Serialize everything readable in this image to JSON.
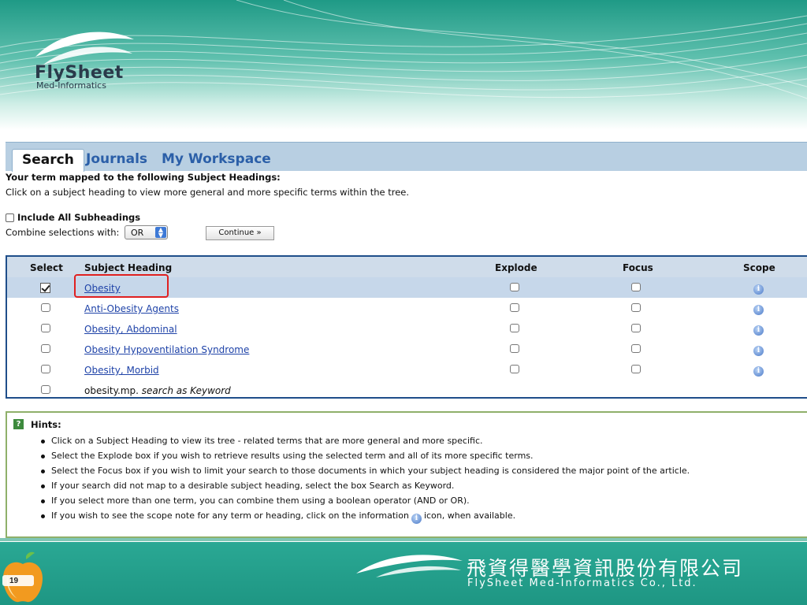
{
  "brand": {
    "logo_name": "FlySheet",
    "logo_sub": "Med-Informatics",
    "company_cn": "飛資得醫學資訊股份有限公司",
    "company_en": "FlySheet Med-Informatics Co., Ltd.",
    "primary_color": "#1e9683",
    "accent_blue": "#2b5fa8"
  },
  "tabs": [
    {
      "label": "Search"
    },
    {
      "label": "Journals"
    },
    {
      "label": "My Workspace"
    }
  ],
  "intro": {
    "title": "Your term mapped to the following Subject Headings:",
    "text": "Click on a subject heading to view more general and more specific terms within the tree."
  },
  "options": {
    "include_subheadings": "Include All Subheadings",
    "combine_label": "Combine selections with:",
    "combine_value": "OR",
    "continue_label": "Continue »"
  },
  "table": {
    "headers": {
      "select": "Select",
      "subject": "Subject Heading",
      "explode": "Explode",
      "focus": "Focus",
      "scope": "Scope"
    },
    "rows": [
      {
        "subject": "Obesity",
        "selected": true
      },
      {
        "subject": "Anti-Obesity Agents",
        "selected": false
      },
      {
        "subject": "Obesity, Abdominal",
        "selected": false
      },
      {
        "subject": "Obesity Hypoventilation Syndrome",
        "selected": false
      },
      {
        "subject": "Obesity, Morbid",
        "selected": false
      }
    ],
    "keyword_row": {
      "term": "obesity.mp.",
      "suffix": "search as Keyword"
    }
  },
  "hints": {
    "title": "Hints:",
    "items": [
      "Click on a Subject Heading to view its tree - related terms that are more general and more specific.",
      "Select the Explode box if you wish to retrieve results using the selected term and all of its more specific terms.",
      "Select the Focus box if you wish to limit your search to those documents in which your subject heading is considered the major point of the article.",
      "If your search did not map to a desirable subject heading, select the box Search as Keyword.",
      "If you select more than one term, you can combine them using a boolean operator (AND or OR)."
    ],
    "last_before": "If you wish to see the scope note for any term or heading, click on the information",
    "last_after": "icon, when available."
  },
  "slide": {
    "page_number": "19"
  }
}
